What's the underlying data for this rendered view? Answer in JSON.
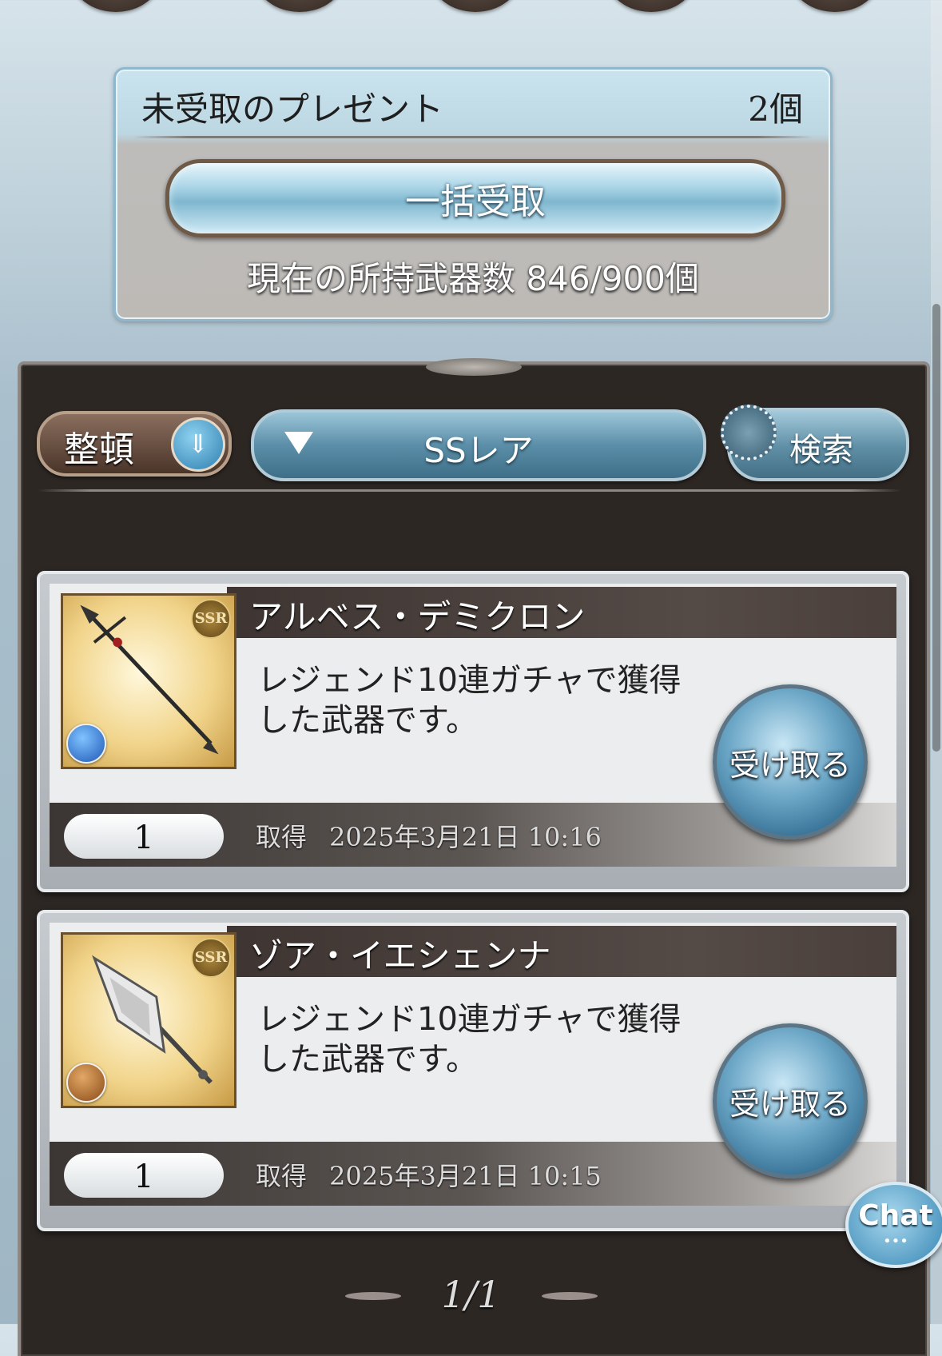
{
  "present": {
    "label": "未受取のプレゼント",
    "count": "2個",
    "bulk_receive_label": "一括受取",
    "weapon_count_label": "現在の所持武器数 846/900個"
  },
  "toolbar": {
    "sort_label": "整頓",
    "filter_label": "SSレア",
    "search_label": "検索"
  },
  "items": [
    {
      "name": "アルベス・デミクロン",
      "description": "レジェンド10連ガチャで獲得した武器です。",
      "rarity": "SSR",
      "element_icon": "water-element-icon",
      "quantity": "1",
      "acquired_label": "取得",
      "acquired_date": "2025年3月21日 10:16",
      "receive_label": "受け取る"
    },
    {
      "name": "ゾア・イエシェンナ",
      "description": "レジェンド10連ガチャで獲得した武器です。",
      "rarity": "SSR",
      "element_icon": "earth-element-icon",
      "quantity": "1",
      "acquired_label": "取得",
      "acquired_date": "2025年3月21日 10:15",
      "receive_label": "受け取る"
    }
  ],
  "pagination": "1/1",
  "chat": {
    "label": "Chat",
    "dots": "•••"
  }
}
